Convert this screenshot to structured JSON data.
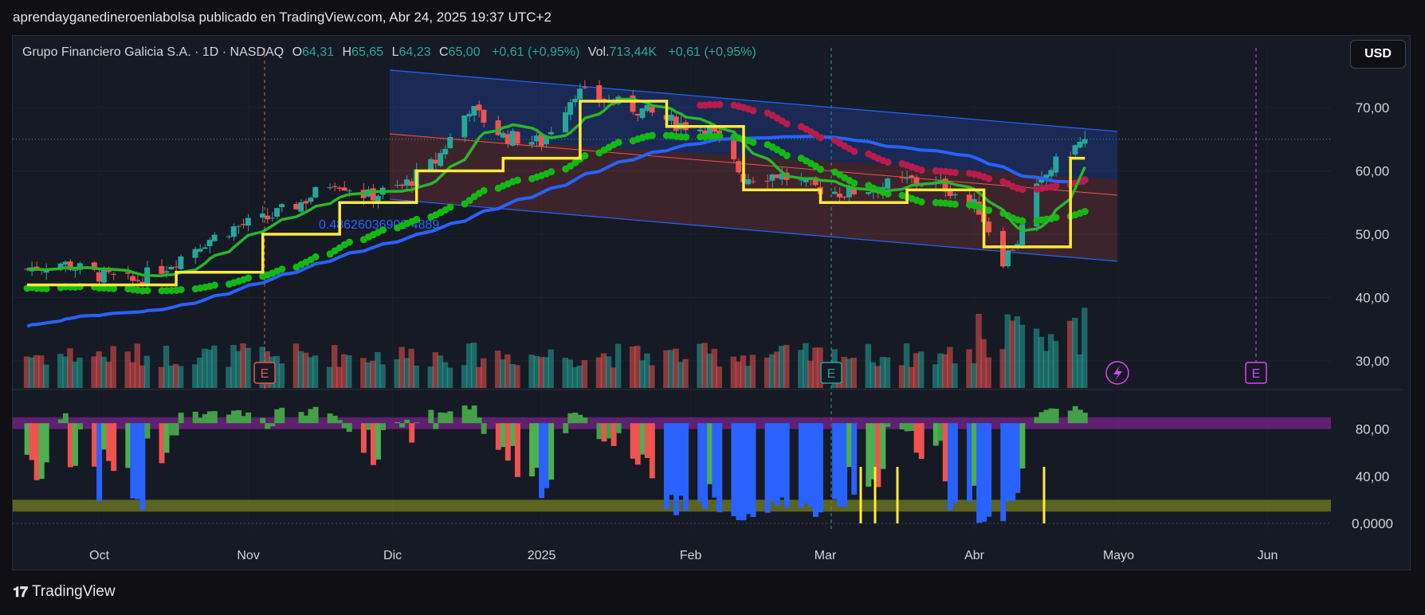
{
  "header": {
    "published": "aprendayganedineroenlabolsa publicado en TradingView.com, Abr 24, 2025 19:37 UTC+2"
  },
  "legend": {
    "symbol": "Grupo Financiero Galicia S.A. · 1D · NASDAQ",
    "o_label": "O",
    "o_value": "64,31",
    "h_label": "H",
    "h_value": "65,65",
    "l_label": "L",
    "l_value": "64,23",
    "c_label": "C",
    "c_value": "65,00",
    "change": "+0,61 (+0,95%)",
    "vol_label": "Vol.",
    "vol_value": "713,44K",
    "vol_change": "+0,61 (+0,95%)"
  },
  "currency_button": "USD",
  "channel_label": "0.48626036902 4889",
  "earnings_markers": [
    "E",
    "E",
    "E"
  ],
  "footer": {
    "brand": "TradingView",
    "logo_icon": "tradingview-logo-icon"
  },
  "colors": {
    "up": "#26a69a",
    "down": "#ef5350",
    "yellow": "#ffeb3b",
    "green": "#17c317",
    "blue": "#2962ff",
    "red": "#c2185b"
  },
  "chart_data": [
    {
      "type": "candlestick",
      "symbol": "GGAL",
      "interval": "1D",
      "ylim": [
        26,
        78
      ],
      "y_ticks": [
        "70,00",
        "60,00",
        "50,00",
        "40,00",
        "30,00"
      ],
      "x_ticks": [
        "Oct",
        "Nov",
        "Dic",
        "2025",
        "Feb",
        "Mar",
        "Abr",
        "Mayo",
        "Jun"
      ],
      "last_price": 65.0,
      "close_path": [
        [
          "2024-09-16",
          44.5
        ],
        [
          "2024-09-23",
          45.5
        ],
        [
          "2024-10-01",
          43.5
        ],
        [
          "2024-10-08",
          42.5
        ],
        [
          "2024-10-15",
          45.0
        ],
        [
          "2024-10-22",
          48.5
        ],
        [
          "2024-10-29",
          51.0
        ],
        [
          "2024-11-05",
          52.5
        ],
        [
          "2024-11-12",
          55.0
        ],
        [
          "2024-11-19",
          58.5
        ],
        [
          "2024-11-26",
          56.0
        ],
        [
          "2024-12-03",
          57.5
        ],
        [
          "2024-12-10",
          61.5
        ],
        [
          "2024-12-17",
          70.0
        ],
        [
          "2024-12-24",
          65.5
        ],
        [
          "2025-01-01",
          64.5
        ],
        [
          "2025-01-08",
          72.5
        ],
        [
          "2025-01-15",
          71.0
        ],
        [
          "2025-01-22",
          69.5
        ],
        [
          "2025-01-29",
          67.5
        ],
        [
          "2025-02-05",
          66.5
        ],
        [
          "2025-02-12",
          59.0
        ],
        [
          "2025-02-19",
          59.5
        ],
        [
          "2025-02-26",
          57.5
        ],
        [
          "2025-03-05",
          56.5
        ],
        [
          "2025-03-12",
          57.5
        ],
        [
          "2025-03-19",
          58.5
        ],
        [
          "2025-03-26",
          57.5
        ],
        [
          "2025-04-02",
          54.0
        ],
        [
          "2025-04-07",
          46.0
        ],
        [
          "2025-04-10",
          49.0
        ],
        [
          "2025-04-14",
          57.0
        ],
        [
          "2025-04-17",
          60.5
        ],
        [
          "2025-04-24",
          65.0
        ]
      ]
    },
    {
      "type": "bar",
      "name": "Vol.",
      "note": "volume histogram at chart bottom, unlabeled scale"
    },
    {
      "type": "bar",
      "name": "oscillator",
      "ylim": [
        -5,
        100
      ],
      "y_ticks": [
        "80,00",
        "40,00",
        "0,0000"
      ],
      "upper_band": [
        80,
        90
      ],
      "lower_band": [
        10,
        20
      ]
    }
  ]
}
